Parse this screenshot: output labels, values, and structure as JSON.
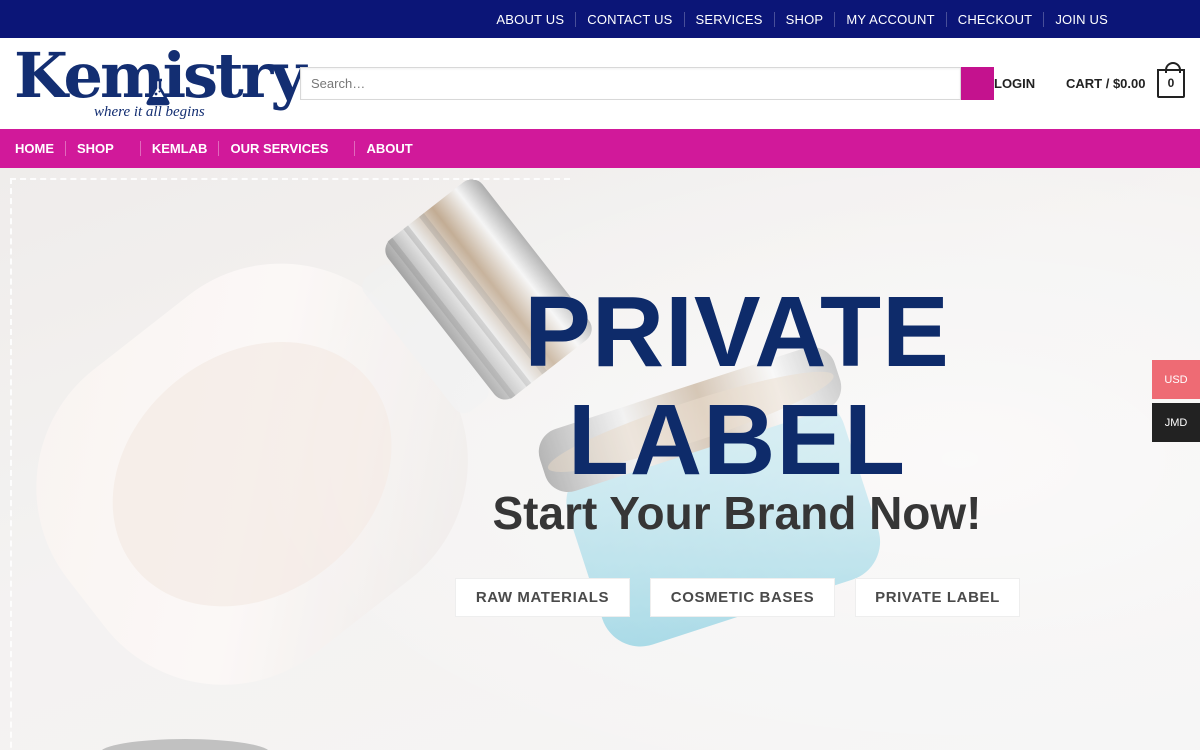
{
  "top_nav": [
    "ABOUT US",
    "CONTACT US",
    "SERVICES",
    "SHOP",
    "MY ACCOUNT",
    "CHECKOUT",
    "JOIN US"
  ],
  "brand": {
    "name": "Kemistry",
    "tagline": "where it all begins"
  },
  "search": {
    "placeholder": "Search…"
  },
  "header": {
    "login": "LOGIN",
    "cart": "CART / $0.00",
    "cart_count": "0"
  },
  "main_nav": [
    "HOME",
    "SHOP",
    "KEMLAB",
    "OUR SERVICES",
    "ABOUT"
  ],
  "hero": {
    "title_line1": "PRIVATE",
    "title_line2": "LABEL",
    "subtitle": "Start Your Brand Now!",
    "buttons": [
      "RAW MATERIALS",
      "COSMETIC BASES",
      "PRIVATE LABEL"
    ]
  },
  "currency": {
    "usd": "USD",
    "jmd": "JMD"
  },
  "colors": {
    "top_bar": "#0b1577",
    "nav": "#d1199a",
    "accent": "#c4128e",
    "title": "#0e2b6a",
    "usd": "#ee6b74"
  },
  "icons": [
    "search-icon",
    "cart-bag-icon",
    "flask-icon"
  ]
}
